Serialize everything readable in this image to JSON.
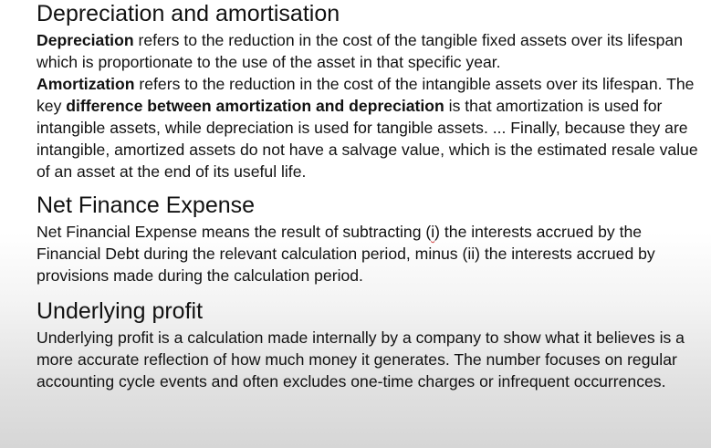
{
  "sections": {
    "depreciation": {
      "heading": "Depreciation and amortisation",
      "p1_term": "Depreciation",
      "p1_text": " refers to the reduction in the cost of the tangible fixed assets over its lifespan which is proportionate to the use of the asset in that specific year.",
      "p2_term": "Amortization",
      "p2_text_a": " refers to the reduction in the cost of the intangible assets over its lifespan. The key ",
      "p2_bold": "difference between amortization and depreciation",
      "p2_text_b": " is that amortization is used for intangible assets, while depreciation is used for tangible assets. ... Finally, because they are intangible, amortized assets do not have a salvage value, which is the estimated resale value of an asset at the end of its useful life."
    },
    "net_finance": {
      "heading": "Net Finance Expense",
      "text_a": "Net Financial Expense means the result of subtracting (",
      "misspelled": "i",
      "text_b": ") the interests accrued by the Financial Debt during the relevant calculation period, minus (ii) the interests accrued by provisions made during the calculation period."
    },
    "underlying": {
      "heading": "Underlying profit",
      "text": "Underlying profit is a calculation made internally by a company to show what it believes is a more accurate reflection of how much money it generates. The number focuses on regular accounting cycle events and often excludes one-time charges or infrequent occurrences."
    }
  },
  "colors": {
    "text": "#111111",
    "spellcheck_underline": "#d23c3c"
  }
}
